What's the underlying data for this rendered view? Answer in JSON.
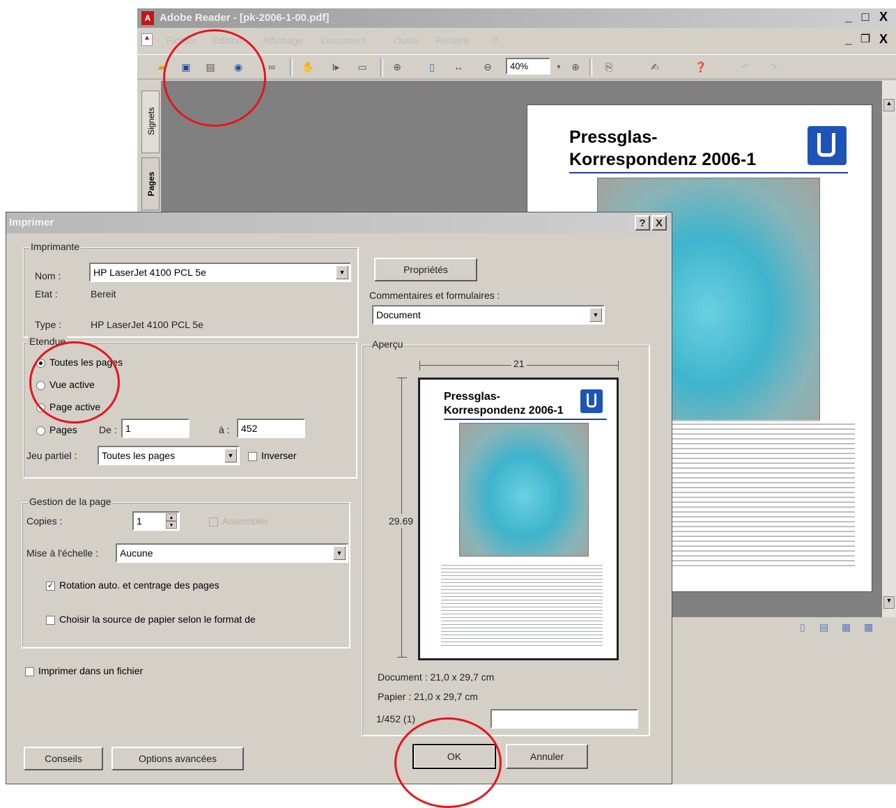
{
  "app": {
    "title": "Adobe Reader - [pk-2006-1-00.pdf]",
    "menu": [
      "Fichier",
      "Edition",
      "Affichage",
      "Document",
      "Outils",
      "Fenêtre",
      "?"
    ],
    "zoom": "40%",
    "side_tabs": [
      "Signets",
      "Pages"
    ],
    "window_controls": {
      "min": "_",
      "max": "□",
      "close": "X"
    },
    "doc_controls": {
      "min": "_",
      "restore": "❐",
      "close": "X"
    }
  },
  "document": {
    "title_line1": "Pressglas-",
    "title_line2": "Korrespondenz 2006-1"
  },
  "dialog": {
    "title": "Imprimer",
    "help": "?",
    "close": "X",
    "printer": {
      "group": "Imprimante",
      "name_label": "Nom :",
      "name_value": "HP LaserJet 4100 PCL 5e",
      "state_label": "Etat :",
      "state_value": "Bereit",
      "type_label": "Type :",
      "type_value": "HP LaserJet 4100 PCL 5e",
      "properties_button": "Propriétés",
      "comments_label": "Commentaires et formulaires :",
      "comments_value": "Document"
    },
    "range": {
      "group": "Etendue",
      "all_pages": "Toutes les pages",
      "current_view": "Vue active",
      "current_page": "Page active",
      "pages": "Pages",
      "from_label": "De :",
      "from_value": "1",
      "to_label": "à :",
      "to_value": "452",
      "subset_label": "Jeu partiel :",
      "subset_value": "Toutes les pages",
      "reverse": "Inverser"
    },
    "page_handling": {
      "group": "Gestion de la page",
      "copies_label": "Copies :",
      "copies_value": "1",
      "collate": "Assembler",
      "scaling_label": "Mise à l'échelle :",
      "scaling_value": "Aucune",
      "auto_rotate": "Rotation auto. et centrage des pages",
      "paper_source": "Choisir la source de papier selon le format de"
    },
    "print_to_file": "Imprimer dans un fichier",
    "preview": {
      "group": "Aperçu",
      "width": "21",
      "height": "29.69",
      "doc_title1": "Pressglas-",
      "doc_title2": "Korrespondenz 2006-1",
      "document_size": "Document : 21,0 x 29,7 cm",
      "paper_size": "Papier : 21,0 x 29,7 cm",
      "page_counter": "1/452 (1)"
    },
    "buttons": {
      "tips": "Conseils",
      "advanced": "Options avancées",
      "ok": "OK",
      "cancel": "Annuler"
    }
  },
  "colors": {
    "annotation_circle": "#e8141c",
    "dialog_bg": "#d4d0c8",
    "title_active": "#c4c4c4"
  }
}
